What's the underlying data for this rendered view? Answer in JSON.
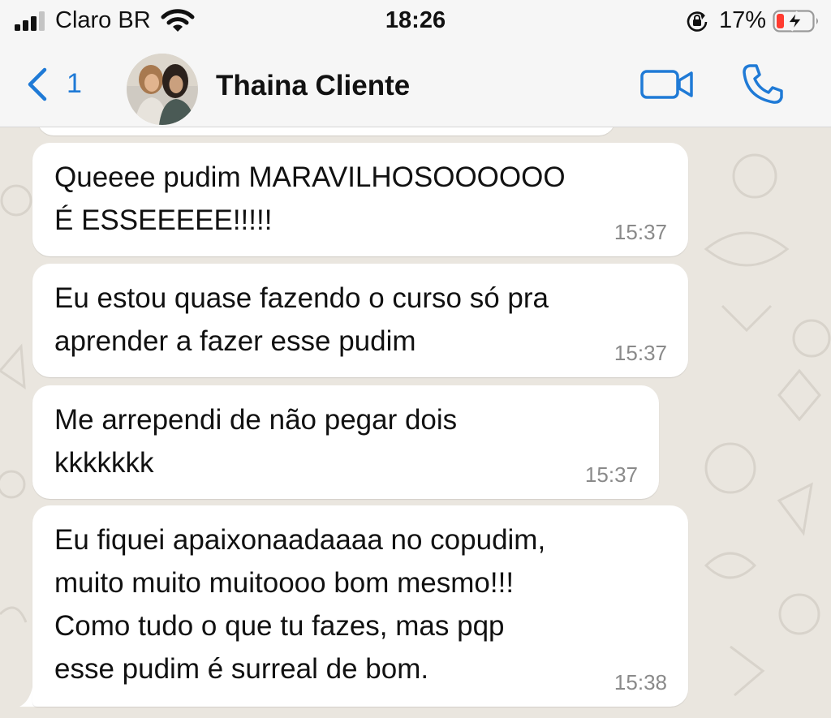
{
  "status_bar": {
    "carrier": "Claro BR",
    "time": "18:26",
    "battery_percent": "17%",
    "icons": [
      "signal-icon",
      "wifi-icon",
      "orientation-lock-icon",
      "battery-low-charging-icon"
    ],
    "battery_color": "#ff3b30"
  },
  "header": {
    "back_count": "1",
    "contact_name": "Thaina Cliente",
    "accent_color": "#1f7ad6",
    "icons": [
      "back-chevron-icon",
      "video-call-icon",
      "phone-call-icon"
    ]
  },
  "messages": [
    {
      "text": "Queeee pudim MARAVILHOSOOOOOO\nÉ ESSEEEEE!!!!!",
      "time": "15:37"
    },
    {
      "text": "Eu estou quase fazendo o curso só pra\naprender a fazer esse pudim",
      "time": "15:37"
    },
    {
      "text": "Me arrependi de não pegar dois\nkkkkkkk",
      "time": "15:37"
    },
    {
      "text": "Eu fiquei apaixonaadaaaa no copudim,\nmuito muito muitoooo bom mesmo!!!\nComo tudo o que tu fazes, mas pqp\nesse pudim é surreal de bom.",
      "time": "15:38"
    }
  ],
  "colors": {
    "chat_background": "#eae6df",
    "bubble": "#ffffff",
    "timestamp": "#8a8a8a"
  }
}
